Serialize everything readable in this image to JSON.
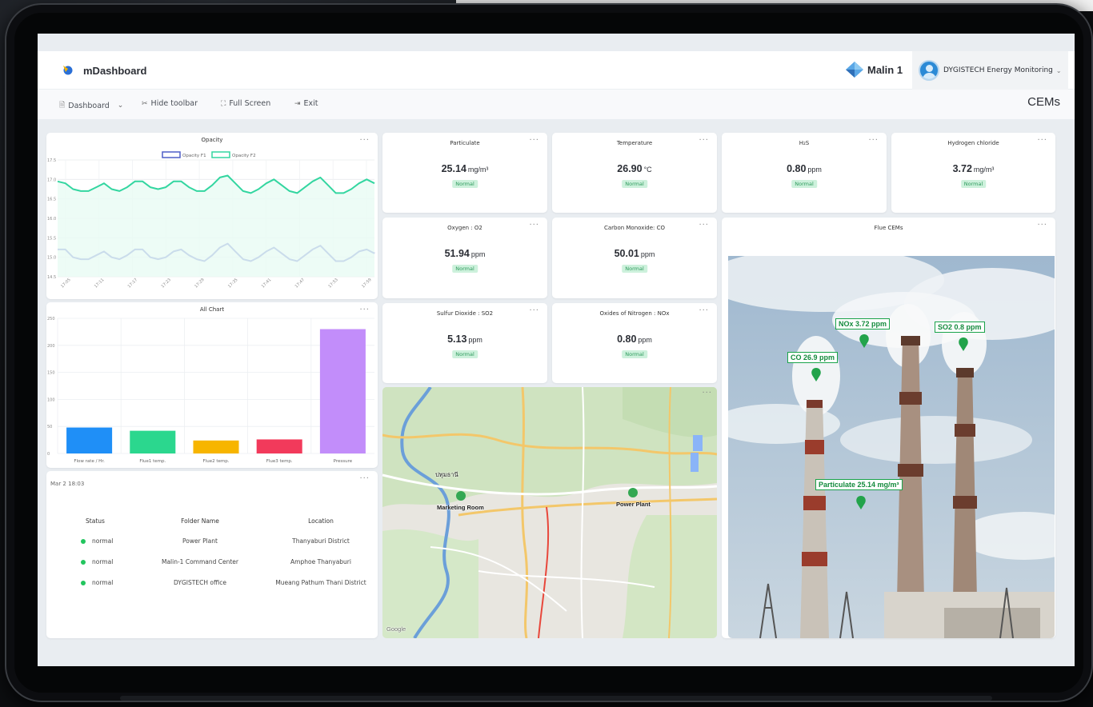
{
  "header": {
    "brand": "mDashboard",
    "malin_name": "Malin 1",
    "org_name": "DYGISTECH Energy Monitoring",
    "org_chevron": "⌄"
  },
  "toolbar": {
    "dashboard_label": "Dashboard",
    "hide_toolbar_label": "Hide toolbar",
    "full_screen_label": "Full Screen",
    "exit_label": "Exit",
    "page_title": "CEMs"
  },
  "opacity_chart": {
    "title": "Opacity",
    "legend": [
      "Opacity F1",
      "Opacity F2"
    ],
    "colors": [
      "#4f5fc7",
      "#33d6a0"
    ],
    "y_ticks": [
      "17.5",
      "17.0",
      "16.5",
      "16.0",
      "15.5",
      "15.0",
      "14.5"
    ],
    "x_ticks": [
      "17:05",
      "17:11",
      "17:17",
      "17:23",
      "17:29",
      "17:35",
      "17:41",
      "17:47",
      "17:53",
      "17:59"
    ]
  },
  "all_chart": {
    "title": "All Chart",
    "y_ticks": [
      "250",
      "200",
      "150",
      "100",
      "50",
      "0"
    ]
  },
  "chart_data": [
    {
      "type": "line",
      "title": "Opacity",
      "ylim": [
        14.5,
        17.5
      ],
      "legend": "top",
      "grid": true,
      "series": [
        {
          "name": "Opacity F1",
          "color": "#4f5fc7",
          "values": [
            15.2,
            15.2,
            15.0,
            14.95,
            14.95,
            15.05,
            15.15,
            15.0,
            14.95,
            15.05,
            15.2,
            15.2,
            15.0,
            14.95,
            15.0,
            15.15,
            15.2,
            15.05,
            14.95,
            14.9,
            15.05,
            15.25,
            15.35,
            15.15,
            14.95,
            14.9,
            15.0,
            15.15,
            15.25,
            15.1,
            14.95,
            14.9,
            15.05,
            15.2,
            15.3,
            15.1,
            14.9,
            14.9,
            15.0,
            15.15,
            15.2,
            15.1
          ]
        },
        {
          "name": "Opacity F2",
          "color": "#33d6a0",
          "values": [
            16.95,
            16.9,
            16.75,
            16.7,
            16.7,
            16.8,
            16.9,
            16.75,
            16.7,
            16.8,
            16.95,
            16.95,
            16.8,
            16.75,
            16.8,
            16.95,
            16.95,
            16.8,
            16.7,
            16.7,
            16.85,
            17.05,
            17.1,
            16.9,
            16.7,
            16.65,
            16.75,
            16.9,
            17.0,
            16.85,
            16.7,
            16.65,
            16.8,
            16.95,
            17.05,
            16.85,
            16.65,
            16.65,
            16.75,
            16.9,
            17.0,
            16.9
          ]
        }
      ]
    },
    {
      "type": "bar",
      "title": "All Chart",
      "categories": [
        "Flow rate / Hr.",
        "Flue1 temp.",
        "Flue2 temp.",
        "Flue3 temp.",
        "Pressure"
      ],
      "values": [
        48,
        42,
        24,
        26,
        230
      ],
      "colors": [
        "#1f8ff7",
        "#2bd78e",
        "#f7b500",
        "#f23a5b",
        "#c28dfa"
      ],
      "ylim": [
        0,
        250
      ],
      "grid": true
    }
  ],
  "metrics": [
    {
      "title": "Particulate",
      "value": "25.14",
      "unit": "mg/m³",
      "status": "Normal"
    },
    {
      "title": "Temperature",
      "value": "26.90",
      "unit": "°C",
      "status": "Normal"
    },
    {
      "title": "H₂S",
      "value": "0.80",
      "unit": "ppm",
      "status": "Normal"
    },
    {
      "title": "Hydrogen chloride",
      "value": "3.72",
      "unit": "mg/m³",
      "status": "Normal"
    },
    {
      "title": "Oxygen : O2",
      "value": "51.94",
      "unit": "ppm",
      "status": "Normal"
    },
    {
      "title": "Carbon Monoxide: CO",
      "value": "50.01",
      "unit": "ppm",
      "status": "Normal"
    },
    {
      "title": "Sulfur Dioxide : SO2",
      "value": "5.13",
      "unit": "ppm",
      "status": "Normal"
    },
    {
      "title": "Oxides of Nitrogen : NOx",
      "value": "0.80",
      "unit": "ppm",
      "status": "Normal"
    }
  ],
  "status_table": {
    "timestamp": "Mar 2 18:03",
    "headers": [
      "Status",
      "Folder Name",
      "Location"
    ],
    "rows": [
      {
        "status": "normal",
        "folder": "Power Plant",
        "location": "Thanyaburi District"
      },
      {
        "status": "normal",
        "folder": "Malin-1 Command Center",
        "location": "Amphoe Thanyaburi"
      },
      {
        "status": "normal",
        "folder": "DYGISTECH office",
        "location": "Mueang Pathum Thani District"
      }
    ]
  },
  "map": {
    "marker_1": "Marketing Room",
    "marker_2": "Power Plant",
    "city_label": "ปทุมธานี",
    "google": "Google"
  },
  "flue": {
    "title": "Flue CEMs",
    "label_nox": "NOx 3.72 ppm",
    "label_so2": "SO2 0.8  ppm",
    "label_co": "CO 26.9 ppm",
    "label_particulate": "Particulate 25.14 mg/m³"
  },
  "menu_glyph": "···"
}
